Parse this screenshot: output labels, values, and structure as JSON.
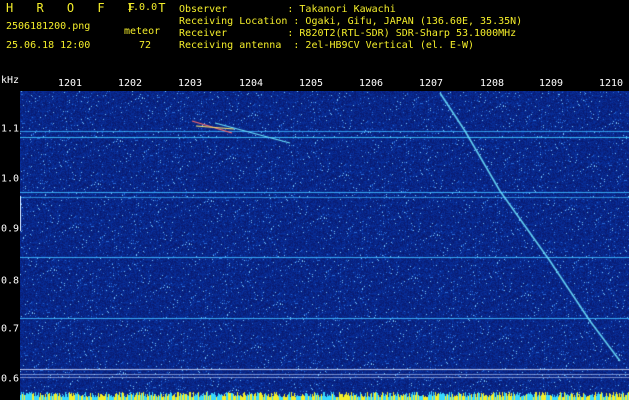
{
  "header": {
    "app_name": "H R O F F T",
    "version": "1.0.0",
    "filename": "2506181200.png",
    "mode": "meteor",
    "datetime": "25.06.18 12:00",
    "count": "72"
  },
  "info": {
    "observer": "Observer          : Takanori Kawachi",
    "location": "Receiving Location : Ogaki, Gifu, JAPAN (136.60E, 35.35N)",
    "receiver": "Receiver          : R820T2(RTL-SDR) SDR-Sharp 53.1000MHz",
    "antenna": "Receiving antenna  : 2el-HB9CV Vertical (el. E-W)"
  },
  "axis": {
    "freq_unit": "kHz",
    "time_labels": [
      "1201",
      "1202",
      "1203",
      "1204",
      "1205",
      "1206",
      "1207",
      "1208",
      "1209",
      "1210"
    ],
    "freq_labels": [
      "1.1",
      "1.0",
      "0.9",
      "0.8",
      "0.7",
      "0.6"
    ]
  },
  "colors": {
    "text_yellow": "#f4ee2a",
    "text_green": "#39e64a",
    "background_blue": "#0a1f8a",
    "signal_cyan": "#4fd8ff"
  }
}
